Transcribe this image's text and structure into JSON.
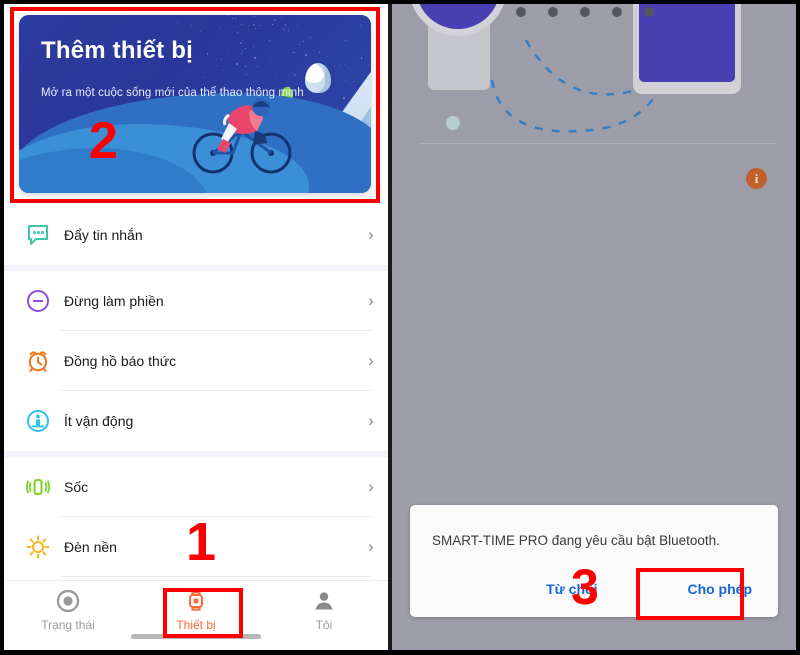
{
  "left_phone": {
    "banner": {
      "title": "Thêm thiết bị",
      "subtitle": "Mở ra một cuộc sống mới của thể thao thông minh",
      "bg_color": "#2b3a96",
      "annotation": "2"
    },
    "list_items": [
      {
        "label": "Đẩy tin nhắn",
        "icon": "message-bubble-icon",
        "icon_color": "#3fc5a8",
        "chevron": "›"
      },
      {
        "label": "Đừng làm phiền",
        "icon": "do-not-disturb-icon",
        "icon_color": "#8a4fe0",
        "chevron": "›"
      },
      {
        "label": "Đồng hồ báo thức",
        "icon": "alarm-clock-icon",
        "icon_color": "#f0741f",
        "chevron": "›"
      },
      {
        "label": "Ít vận động",
        "icon": "sedentary-alert-icon",
        "icon_color": "#2fc2e8",
        "chevron": "›"
      },
      {
        "label": "Sốc",
        "icon": "vibration-icon",
        "icon_color": "#7ed321",
        "chevron": "›"
      },
      {
        "label": "Đèn nền",
        "icon": "backlight-sun-icon",
        "icon_color": "#f5b81c",
        "chevron": "›"
      }
    ],
    "tabbar": {
      "tabs": [
        {
          "label": "Trạng thái",
          "icon": "status-circle-icon",
          "active": false
        },
        {
          "label": "Thiết bị",
          "icon": "watch-icon",
          "active": true
        },
        {
          "label": "Tôi",
          "icon": "person-icon",
          "active": false
        }
      ],
      "active_color": "#f96a35",
      "inactive_color": "#9a9a9a",
      "annotation": "1"
    }
  },
  "right_phone": {
    "overlay_color": "#9d9daa",
    "info_badge": "i",
    "dialog": {
      "message": "SMART-TIME PRO đang yêu cầu bật Bluetooth.",
      "deny_label": "Từ chối",
      "allow_label": "Cho phép",
      "link_color": "#1565d8",
      "annotation": "3"
    }
  },
  "annotations": {
    "color": "#fa0000"
  }
}
